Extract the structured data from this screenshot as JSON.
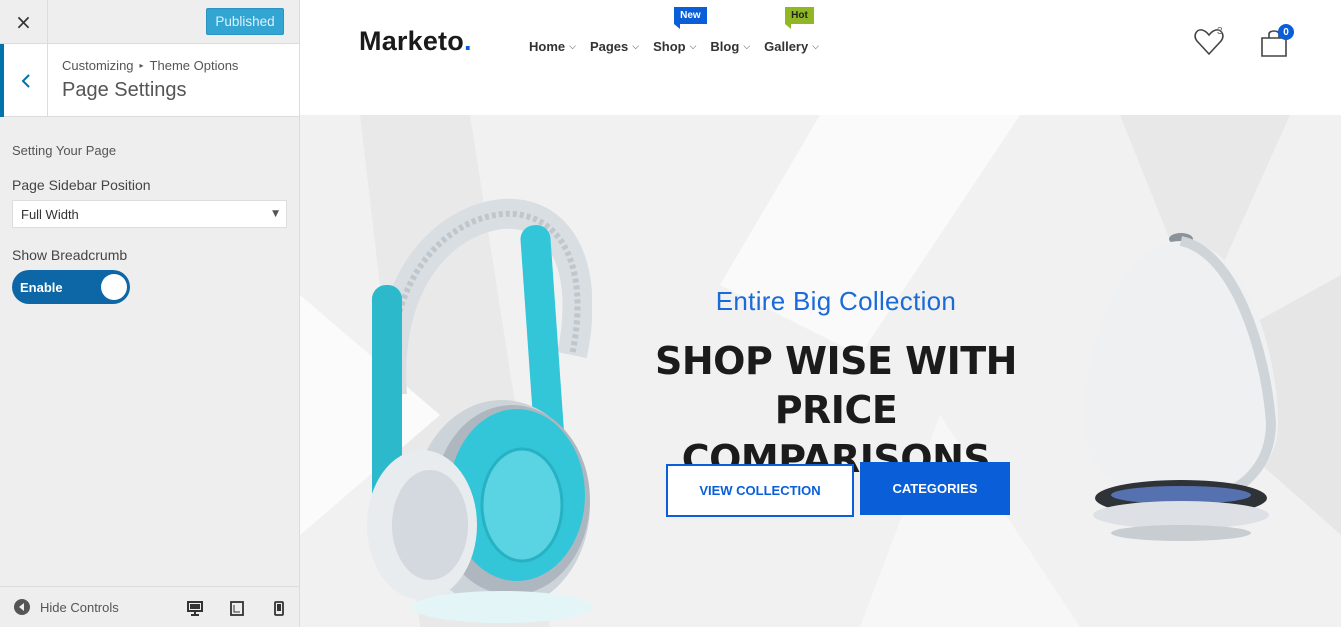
{
  "customizer": {
    "close_label": "×",
    "published_label": "Published",
    "breadcrumb_root": "Customizing",
    "breadcrumb_sep": "▸",
    "breadcrumb_parent": "Theme Options",
    "panel_title": "Page Settings",
    "section_description": "Setting Your Page",
    "sidebar_position": {
      "label": "Page Sidebar Position",
      "selected": "Full Width"
    },
    "breadcrumb_toggle": {
      "label": "Show Breadcrumb",
      "state": "Enable"
    },
    "footer": {
      "hide_controls": "Hide Controls",
      "devices": [
        "desktop-icon",
        "tablet-icon",
        "mobile-icon"
      ]
    }
  },
  "site": {
    "logo": "Marketo",
    "logo_dot": ".",
    "nav": [
      {
        "label": "Home",
        "badge": ""
      },
      {
        "label": "Pages",
        "badge": ""
      },
      {
        "label": "Shop",
        "badge": "New"
      },
      {
        "label": "Blog",
        "badge": ""
      },
      {
        "label": "Gallery",
        "badge": "Hot"
      }
    ],
    "wishlist_count": "3",
    "cart_count": "0",
    "hero": {
      "subtitle": "Entire Big Collection",
      "title_line1": "SHOP WISE WITH PRICE",
      "title_line2": "COMPARISONS",
      "primary_button": "VIEW COLLECTION",
      "secondary_button": "CATEGORIES"
    }
  },
  "colors": {
    "accent_blue": "#0a5ed7",
    "published_button": "#33a5d3",
    "toggle_on": "#0d67a6",
    "hot_badge": "#8fb824",
    "headphone_cyan": "#33c6d8"
  }
}
